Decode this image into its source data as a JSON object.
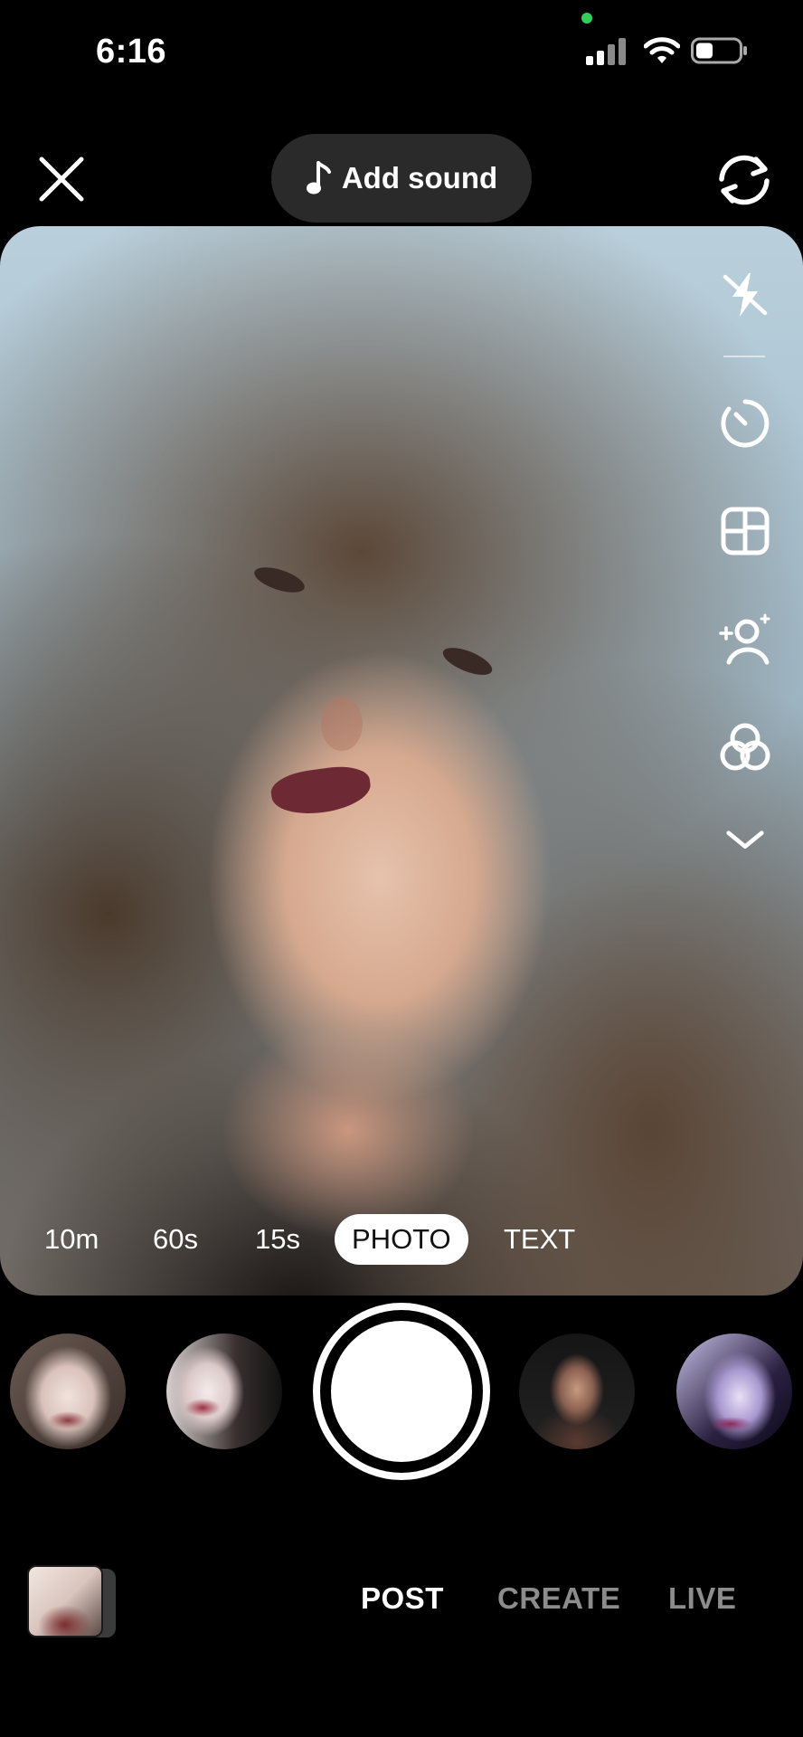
{
  "status_bar": {
    "time": "6:16"
  },
  "top_bar": {
    "add_sound_label": "Add sound"
  },
  "modes": [
    {
      "label": "10m",
      "active": false
    },
    {
      "label": "60s",
      "active": false
    },
    {
      "label": "15s",
      "active": false
    },
    {
      "label": "PHOTO",
      "active": true
    },
    {
      "label": "TEXT",
      "active": false
    }
  ],
  "right_tools": [
    {
      "icon": "flash-off-icon"
    },
    {
      "icon": "timer-icon"
    },
    {
      "icon": "layout-grid-icon"
    },
    {
      "icon": "enhance-person-icon"
    },
    {
      "icon": "filters-icon"
    },
    {
      "icon": "chevron-down-icon"
    }
  ],
  "effects": [
    {
      "name": "effect-1"
    },
    {
      "name": "effect-2"
    },
    {
      "name": "effect-3"
    },
    {
      "name": "effect-4"
    }
  ],
  "bottom_tabs": [
    {
      "label": "POST",
      "active": true
    },
    {
      "label": "CREATE",
      "active": false
    },
    {
      "label": "LIVE",
      "active": false
    }
  ],
  "colors": {
    "background": "#000000",
    "pill": "#2a2a2a",
    "inactive_tab": "#8c8c8c",
    "active_tab": "#ffffff",
    "privacy_dot": "#30d158"
  }
}
